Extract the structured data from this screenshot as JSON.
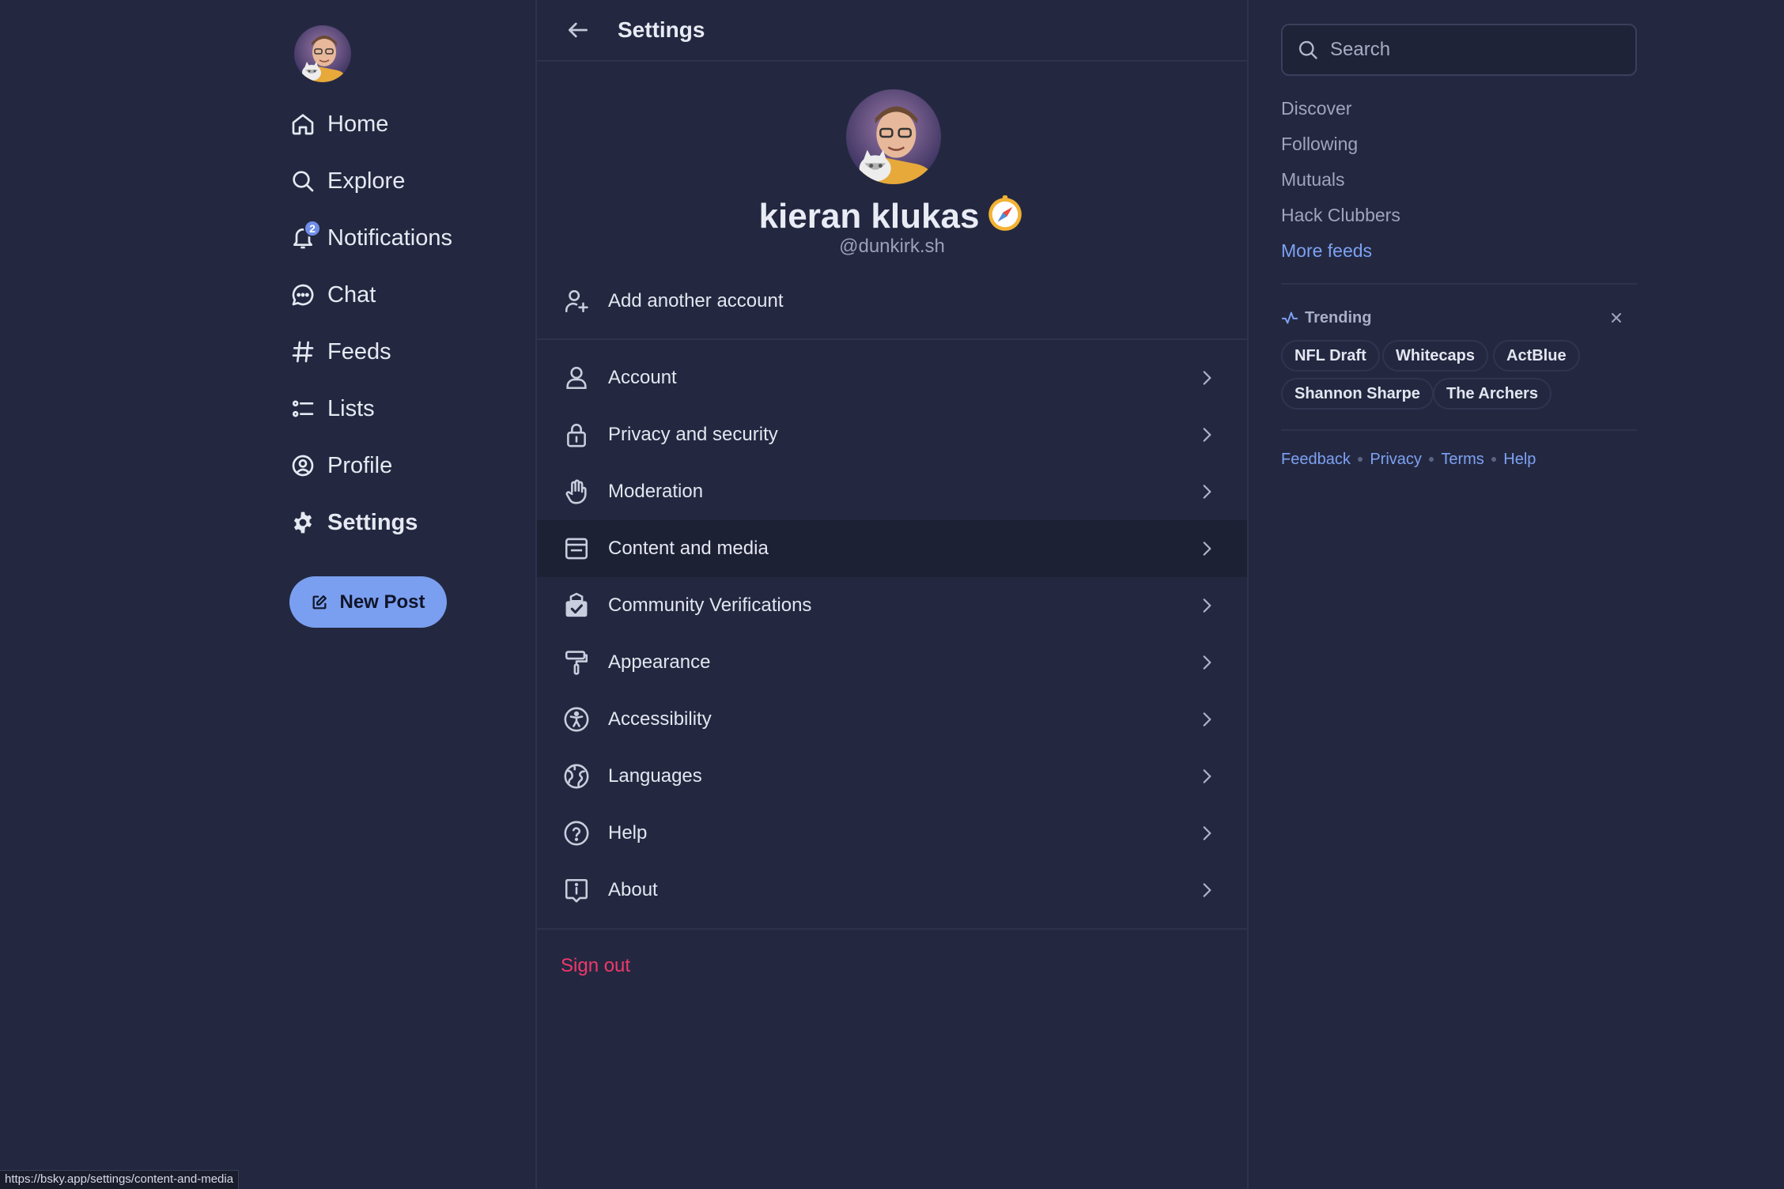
{
  "nav": {
    "items": [
      {
        "label": "Home",
        "icon": "home-icon"
      },
      {
        "label": "Explore",
        "icon": "search-icon"
      },
      {
        "label": "Notifications",
        "icon": "bell-icon",
        "badge": "2"
      },
      {
        "label": "Chat",
        "icon": "chat-bubble-icon"
      },
      {
        "label": "Feeds",
        "icon": "hashtag-icon"
      },
      {
        "label": "Lists",
        "icon": "list-icon"
      },
      {
        "label": "Profile",
        "icon": "user-circle-icon"
      },
      {
        "label": "Settings",
        "icon": "gear-icon",
        "active": true
      }
    ],
    "new_post_label": "New Post"
  },
  "header": {
    "title": "Settings"
  },
  "profile": {
    "display_name": "kieran klukas",
    "handle": "@dunkirk.sh"
  },
  "settings": {
    "add_account_label": "Add another account",
    "items": [
      {
        "label": "Account",
        "icon": "person-icon"
      },
      {
        "label": "Privacy and security",
        "icon": "lock-icon"
      },
      {
        "label": "Moderation",
        "icon": "hand-icon"
      },
      {
        "label": "Content and media",
        "icon": "window-icon",
        "hovered": true
      },
      {
        "label": "Community Verifications",
        "icon": "verified-badge-icon"
      },
      {
        "label": "Appearance",
        "icon": "paint-roller-icon"
      },
      {
        "label": "Accessibility",
        "icon": "accessibility-icon"
      },
      {
        "label": "Languages",
        "icon": "globe-icon"
      },
      {
        "label": "Help",
        "icon": "help-circle-icon"
      },
      {
        "label": "About",
        "icon": "info-icon"
      }
    ],
    "sign_out_label": "Sign out"
  },
  "right": {
    "search_placeholder": "Search",
    "feeds": [
      "Discover",
      "Following",
      "Mutuals",
      "Hack Clubbers"
    ],
    "more_feeds_label": "More feeds",
    "trending_label": "Trending",
    "trending_topics": [
      "NFL Draft",
      "Whitecaps",
      "ActBlue",
      "Shannon Sharpe",
      "The Archers"
    ],
    "footer_links": [
      "Feedback",
      "Privacy",
      "Terms",
      "Help"
    ]
  },
  "status_url": "https://bsky.app/settings/content-and-media",
  "colors": {
    "background": "#232840",
    "accent": "#7a9ff0",
    "danger": "#f0386b"
  }
}
